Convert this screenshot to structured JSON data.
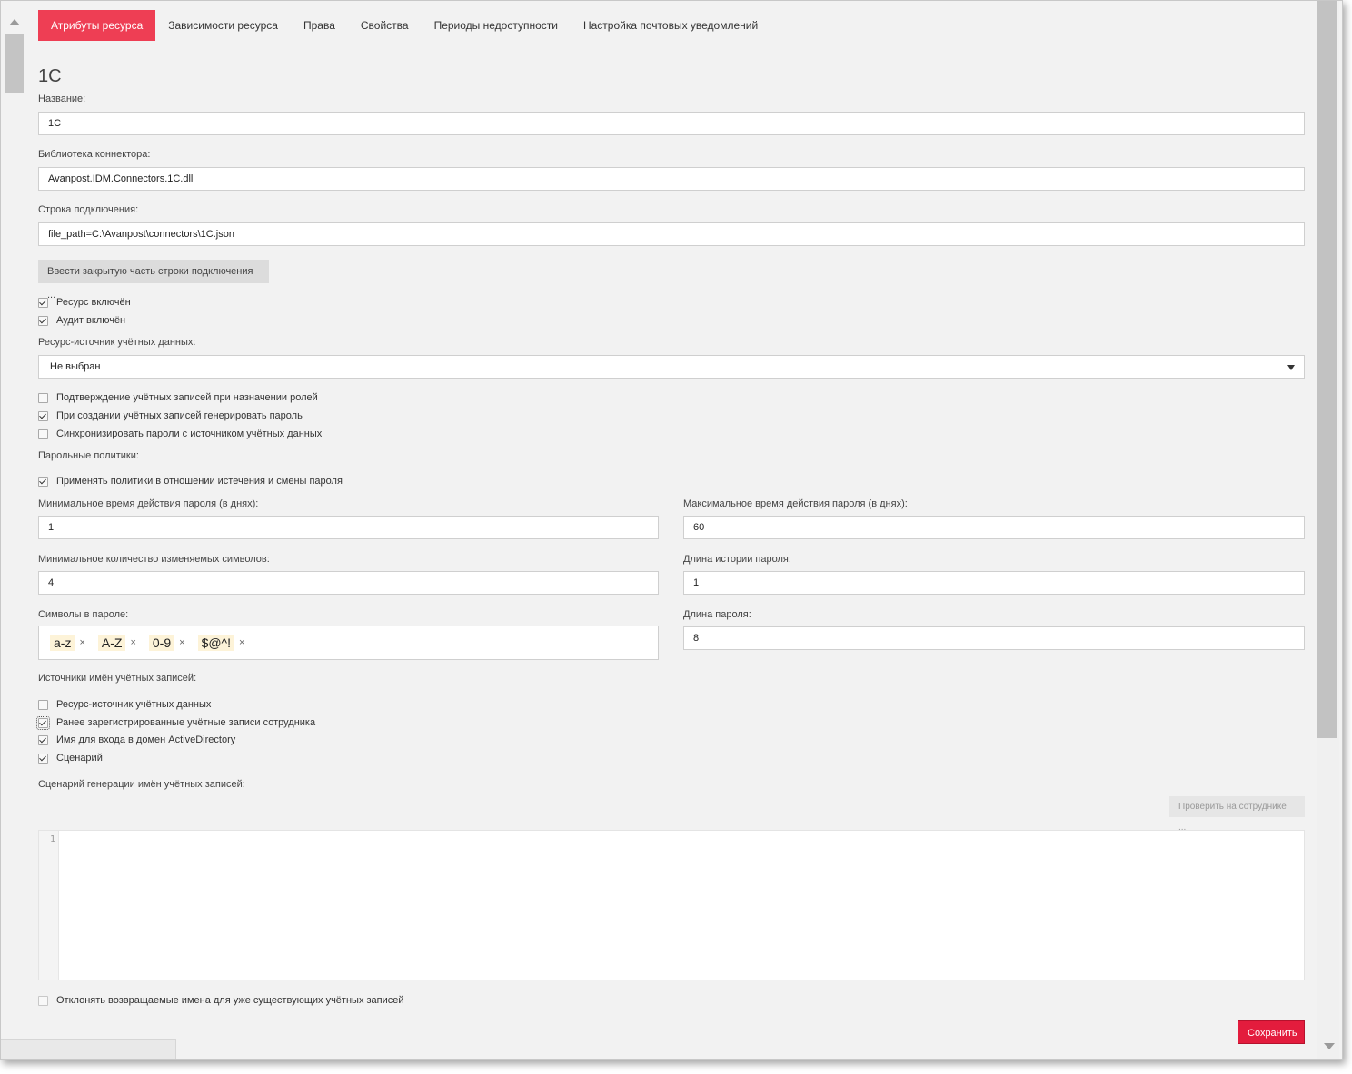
{
  "tabs": [
    "Атрибуты ресурса",
    "Зависимости ресурса",
    "Права",
    "Свойства",
    "Периоды недоступности",
    "Настройка почтовых уведомлений"
  ],
  "page_title": "1C",
  "name": {
    "label": "Название:",
    "value": "1C"
  },
  "connector_library": {
    "label": "Библиотека коннектора:",
    "value": "Avanpost.IDM.Connectors.1C.dll"
  },
  "connection_string": {
    "label": "Строка подключения:",
    "value": "file_path=C:\\Avanpost\\connectors\\1C.json"
  },
  "private_connection_button": "Ввести закрытую часть строки подключения ...",
  "resource_enabled": {
    "label": "Ресурс включён",
    "checked": true
  },
  "audit_enabled": {
    "label": "Аудит включён",
    "checked": true
  },
  "account_source": {
    "label": "Ресурс-источник учётных данных:",
    "value": "Не выбран"
  },
  "account_options": [
    {
      "label": "Подтверждение учётных записей при назначении ролей",
      "checked": false
    },
    {
      "label": "При создании учётных записей генерировать пароль",
      "checked": true
    },
    {
      "label": "Синхронизировать пароли с источником учётных данных",
      "checked": false
    }
  ],
  "password_policies_label": "Парольные политики:",
  "apply_policies": {
    "label": "Применять политики в отношении истечения и смены пароля",
    "checked": true
  },
  "min_password_age": {
    "label": "Минимальное время действия пароля (в днях):",
    "value": "1"
  },
  "max_password_age": {
    "label": "Максимальное время действия пароля (в днях):",
    "value": "60"
  },
  "min_changed_chars": {
    "label": "Минимальное количество изменяемых символов:",
    "value": "4"
  },
  "password_history": {
    "label": "Длина истории пароля:",
    "value": "1"
  },
  "password_chars": {
    "label": "Символы в пароле:",
    "tags": [
      "a-z",
      "A-Z",
      "0-9",
      "$@^!"
    ],
    "remove_glyph": "×"
  },
  "password_length": {
    "label": "Длина пароля:",
    "value": "8"
  },
  "name_sources_label": "Источники имён учётных записей:",
  "name_sources": [
    {
      "label": "Ресурс-источник учётных данных",
      "checked": false
    },
    {
      "label": "Ранее зарегистрированные учётные записи сотрудника",
      "checked": true
    },
    {
      "label": "Имя для входа в домен ActiveDirectory",
      "checked": true
    },
    {
      "label": "Сценарий",
      "checked": true
    }
  ],
  "script_label": "Сценарий генерации имён учётных записей:",
  "check_employee_button": "Проверить на сотруднике ...",
  "editor_line_number": "1",
  "reject_names": {
    "label": "Отклонять возвращаемые имена для уже существующих учётных записей",
    "checked": false
  },
  "save_button": "Сохранить",
  "colors": {
    "accent": "#ee3e54",
    "save": "#e31c3d",
    "tag_bg": "#fdf3d8"
  }
}
